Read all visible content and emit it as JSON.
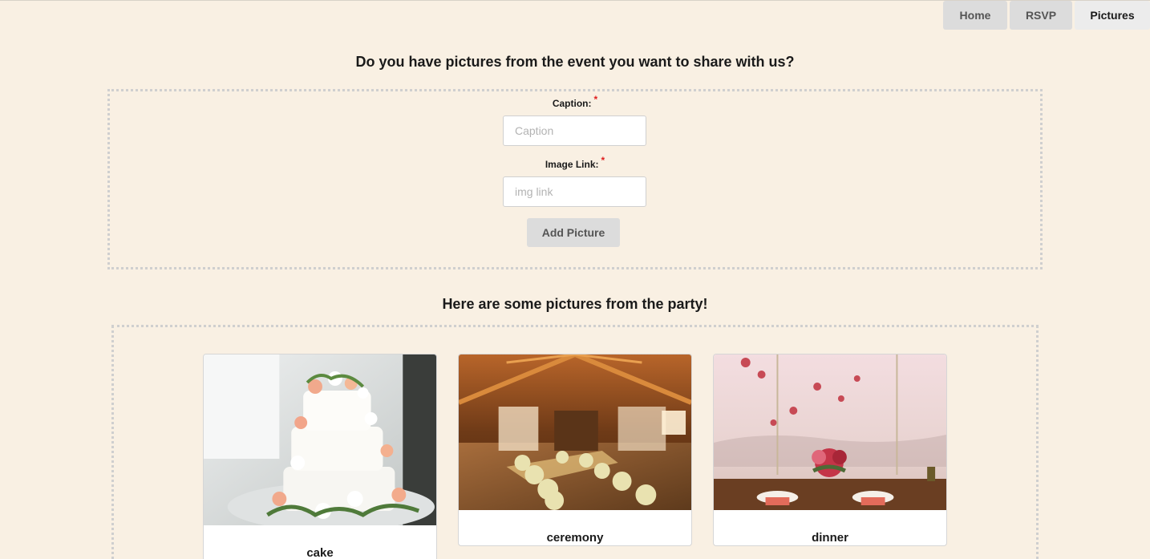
{
  "nav": {
    "items": [
      {
        "label": "Home"
      },
      {
        "label": "RSVP"
      },
      {
        "label": "Pictures"
      }
    ],
    "active": "Pictures"
  },
  "upload": {
    "heading": "Do you have pictures from the event you want to share with us?",
    "caption_label": "Caption:",
    "caption_placeholder": "Caption",
    "caption_value": "",
    "image_label": "Image Link:",
    "image_placeholder": "img link",
    "image_value": "",
    "required_mark": "*",
    "submit_label": "Add Picture"
  },
  "gallery": {
    "heading": "Here are some pictures from the party!",
    "pictures": [
      {
        "caption": "cake",
        "photo": "white tiered wedding cake with flowers"
      },
      {
        "caption": "ceremony",
        "photo": "rustic wooden barn ceremony with flowers"
      },
      {
        "caption": "dinner",
        "photo": "table setting with red floral centerpiece"
      }
    ]
  },
  "colors": {
    "background": "#f9f0e3",
    "button": "#dcdcdc",
    "required": "#e02020"
  }
}
